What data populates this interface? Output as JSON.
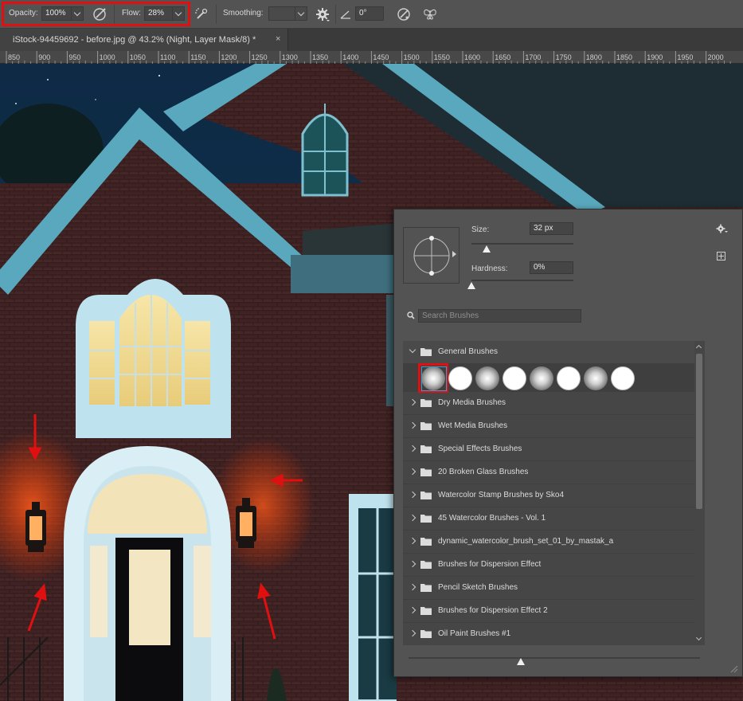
{
  "options_bar": {
    "opacity_label": "Opacity:",
    "opacity_value": "100%",
    "flow_label": "Flow:",
    "flow_value": "28%",
    "smoothing_label": "Smoothing:",
    "smoothing_value": "",
    "angle_value": "0°",
    "icons": [
      "pressure-opacity-icon",
      "airbrush-icon",
      "smoothing-settings-gear-icon",
      "angle-icon",
      "pressure-size-icon",
      "symmetry-butterfly-icon"
    ],
    "highlight_color": "#e01010"
  },
  "document_tab": {
    "title": "iStock-94459692 - before.jpg @ 43.2% (Night, Layer Mask/8) *",
    "close": "×"
  },
  "ruler": {
    "ticks": [
      "850",
      "900",
      "950",
      "1000",
      "1050",
      "1100",
      "1150",
      "1200",
      "1250",
      "1300",
      "1350",
      "1400",
      "1450",
      "1500",
      "1550",
      "1600",
      "1650",
      "1700",
      "1750",
      "1800",
      "1850",
      "1900",
      "1950",
      "2000"
    ]
  },
  "brush_panel": {
    "size_label": "Size:",
    "size_value": "32 px",
    "size_level": 0.03,
    "hardness_label": "Hardness:",
    "hardness_value": "0%",
    "hardness_level": 0.0,
    "search_placeholder": "Search Brushes",
    "expanded_group": "General Brushes",
    "brush_tips": [
      "soft",
      "hard",
      "soft",
      "hard",
      "soft",
      "hard",
      "soft",
      "hard"
    ],
    "selected_tip_index": 0,
    "folders": [
      "Dry Media Brushes",
      "Wet Media Brushes",
      "Special Effects Brushes",
      "20 Broken Glass Brushes",
      "Watercolor Stamp Brushes by Sko4",
      "45 Watercolor Brushes - Vol. 1",
      "dynamic_watercolor_brush_set_01_by_mastak_a",
      "Brushes for Dispersion Effect",
      "Pencil Sketch Brushes",
      "Brushes for Dispersion Effect 2",
      "Oil Paint Brushes #1"
    ],
    "selection_color": "#39a0d6"
  },
  "canvas": {
    "subject": "house",
    "annotation_arrow_color": "#e01010"
  }
}
